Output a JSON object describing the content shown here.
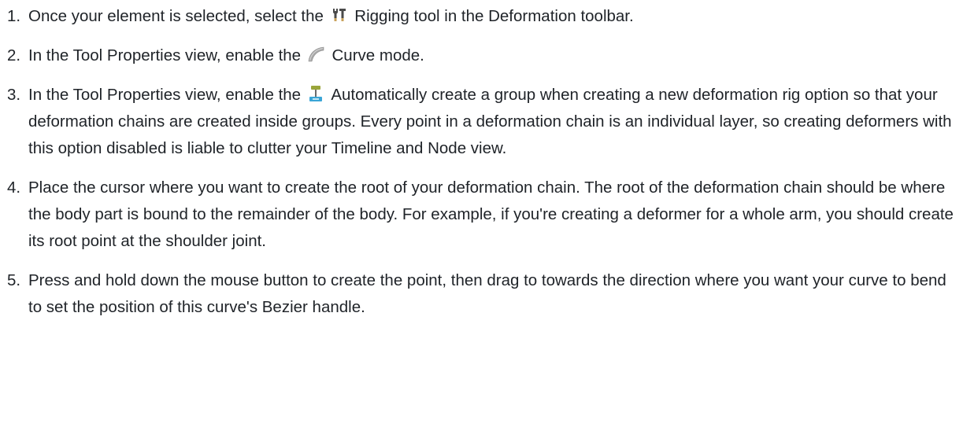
{
  "steps": [
    {
      "number": "1.",
      "before": "Once your element is selected, select the",
      "icon": "rigging-tool-icon",
      "after": "Rigging tool in the Deformation toolbar."
    },
    {
      "number": "2.",
      "before": "In the Tool Properties view, enable the",
      "icon": "curve-mode-icon",
      "after": "Curve mode."
    },
    {
      "number": "3.",
      "before": "In the Tool Properties view, enable the",
      "icon": "auto-group-icon",
      "after": "Automatically create a group when creating a new deformation rig option so that your deformation chains are created inside groups. Every point in a deformation chain is an individual layer, so creating deformers with this option disabled is liable to clutter your Timeline and Node view."
    },
    {
      "number": "4.",
      "text": "Place the cursor where you want to create the root of your deformation chain. The root of the deformation chain should be where the body part is bound to the remainder of the body. For example, if you're creating a deformer for a whole arm, you should create its root point at the shoulder joint."
    },
    {
      "number": "5.",
      "text": "Press and hold down the mouse button to create the point, then drag to towards the direction where you want your curve to bend to set the position of this curve's Bezier handle."
    }
  ]
}
